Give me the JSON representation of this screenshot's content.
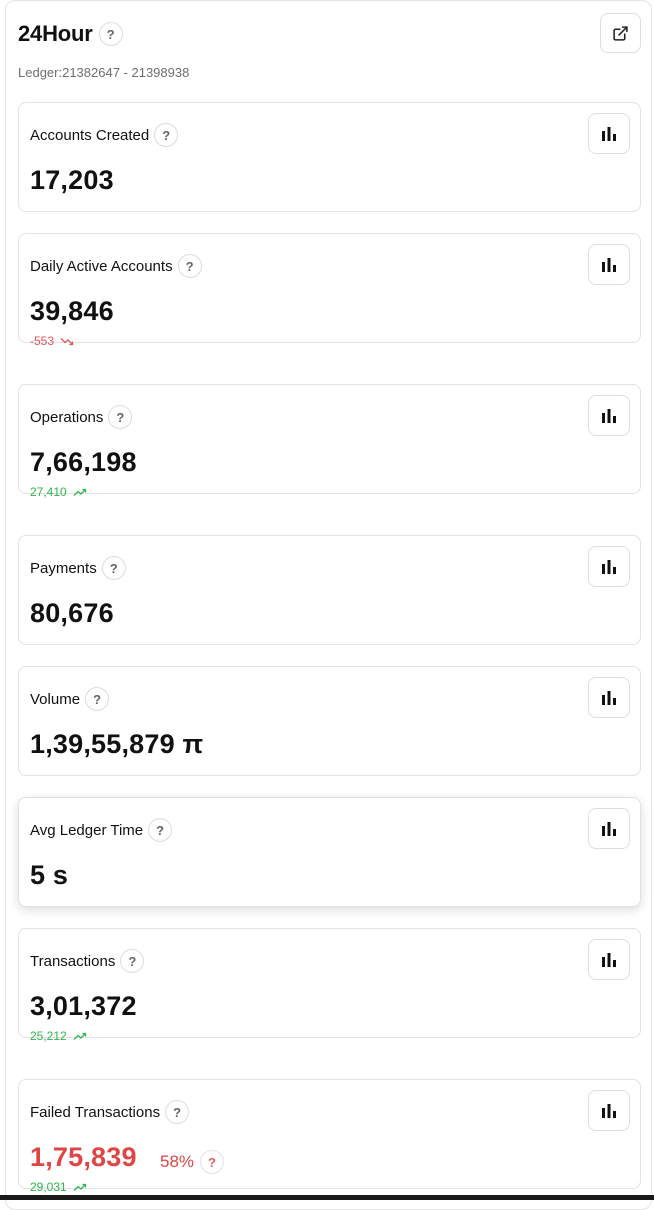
{
  "header": {
    "title": "24Hour",
    "help_symbol": "?",
    "subtitle": "Ledger:21382647 - 21398938",
    "external_icon": "external-link-icon"
  },
  "colors": {
    "negative": "#e05555",
    "positive": "#2bb54d",
    "failed_value": "#e04545"
  },
  "cards": [
    {
      "label": "Accounts Created",
      "value": "17,203",
      "help": "?",
      "icon": "bar-chart-icon"
    },
    {
      "label": "Daily Active Accounts",
      "value": "39,846",
      "help": "?",
      "icon": "bar-chart-icon",
      "delta": {
        "text": "-553",
        "direction": "down"
      }
    },
    {
      "label": "Operations",
      "value": "7,66,198",
      "help": "?",
      "icon": "bar-chart-icon",
      "delta": {
        "text": "27,410",
        "direction": "up"
      }
    },
    {
      "label": "Payments",
      "value": "80,676",
      "help": "?",
      "icon": "bar-chart-icon"
    },
    {
      "label": "Volume",
      "value": "1,39,55,879 π",
      "help": "?",
      "icon": "bar-chart-icon"
    },
    {
      "label": "Avg Ledger Time",
      "value": "5 s",
      "help": "?",
      "icon": "bar-chart-icon"
    },
    {
      "label": "Transactions",
      "value": "3,01,372",
      "help": "?",
      "icon": "bar-chart-icon",
      "delta": {
        "text": "25,212",
        "direction": "up"
      }
    },
    {
      "label": "Failed Transactions",
      "value": "1,75,839",
      "help": "?",
      "icon": "bar-chart-icon",
      "percent": "58%",
      "percent_help": "?",
      "delta": {
        "text": "29,031",
        "direction": "up"
      }
    }
  ]
}
